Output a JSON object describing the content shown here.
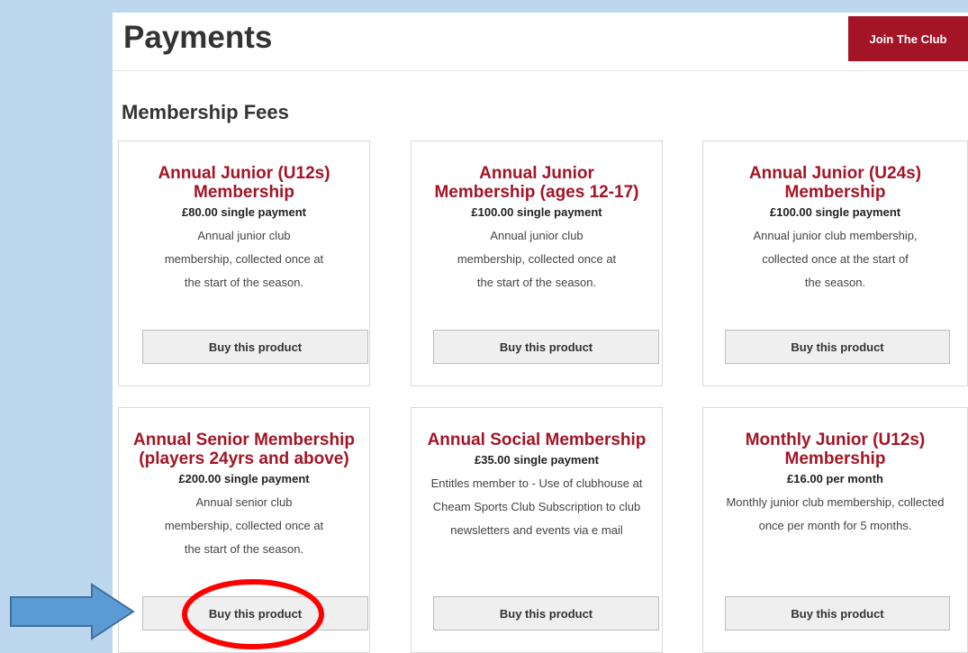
{
  "header": {
    "title": "Payments",
    "join_label": "Join The Club"
  },
  "section": {
    "heading": "Membership Fees"
  },
  "products": [
    {
      "title": "Annual Junior (U12s) Membership",
      "price": "£80.00 single payment",
      "description": "Annual junior club membership, collected once at the start of the season.",
      "button": "Buy this product"
    },
    {
      "title": "Annual Junior Membership (ages 12-17)",
      "price": "£100.00 single payment",
      "description": "Annual junior club membership, collected once at the start of the season.",
      "button": "Buy this product"
    },
    {
      "title": "Annual Junior (U24s) Membership",
      "price": "£100.00 single payment",
      "description": "Annual junior club membership, collected once at the start of the season.",
      "button": "Buy this product"
    },
    {
      "title": "Annual Senior Membership (players 24yrs and above)",
      "price": "£200.00 single payment",
      "description": "Annual senior club membership, collected once at the start of the season.",
      "button": "Buy this product"
    },
    {
      "title": "Annual Social Membership",
      "price": "£35.00 single payment",
      "description": "Entitles member to - Use of clubhouse at Cheam Sports Club Subscription to club newsletters and events via e mail",
      "button": "Buy this product"
    },
    {
      "title": "Monthly Junior (U12s) Membership",
      "price": "£16.00 per month",
      "description": "Monthly junior club membership, collected once per month for 5 months.",
      "button": "Buy this product"
    }
  ],
  "annotations": {
    "arrow_icon": "right-arrow-icon",
    "highlight_icon": "highlight-circle-icon",
    "arrow_color": "#5b9bd5",
    "circle_color": "#ff0000"
  },
  "colors": {
    "brand": "#a31526",
    "background": "#bdd7ee"
  }
}
